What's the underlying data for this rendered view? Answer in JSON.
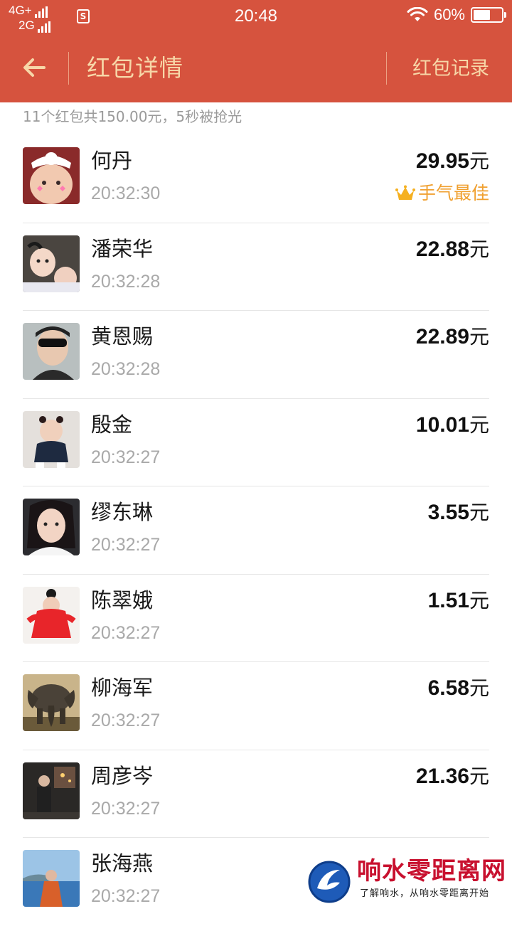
{
  "status_bar": {
    "network_top": "4G+",
    "network_bottom": "2G",
    "sim_icon": "S",
    "time": "20:48",
    "battery_percent": "60%",
    "battery_level": 0.6
  },
  "header": {
    "title": "红包详情",
    "record_label": "红包记录",
    "back_icon": "arrow-left-icon",
    "accent_color": "#d6533e",
    "text_color": "#f7d7a8"
  },
  "summary": "11个红包共150.00元，5秒被抢光",
  "best_luck_label": "手气最佳",
  "currency_unit": "元",
  "entries": [
    {
      "name": "何丹",
      "time": "20:32:30",
      "amount": "29.95"
    },
    {
      "name": "潘荣华",
      "time": "20:32:28",
      "amount": "22.88"
    },
    {
      "name": "黄恩赐",
      "time": "20:32:28",
      "amount": "22.89"
    },
    {
      "name": "殷金",
      "time": "20:32:27",
      "amount": "10.01"
    },
    {
      "name": "缪东琳",
      "time": "20:32:27",
      "amount": "3.55"
    },
    {
      "name": "陈翠娥",
      "time": "20:32:27",
      "amount": "1.51"
    },
    {
      "name": "柳海军",
      "time": "20:32:27",
      "amount": "6.58"
    },
    {
      "name": "周彦岑",
      "time": "20:32:27",
      "amount": "21.36"
    },
    {
      "name": "张海燕",
      "time": "20:32:27",
      "amount": ""
    }
  ],
  "watermark": {
    "title": "响水零距离网",
    "subtitle": "了解响水，从响水零距离开始"
  }
}
